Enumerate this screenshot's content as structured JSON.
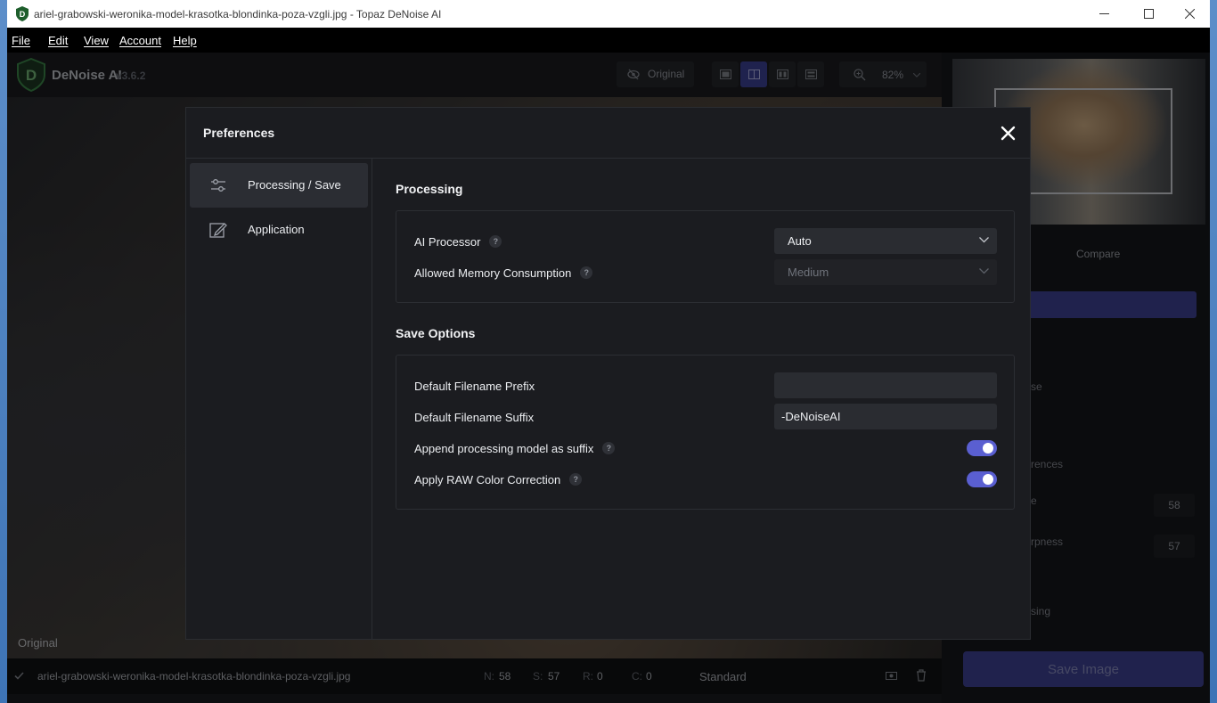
{
  "window": {
    "title": "ariel-grabowski-weronika-model-krasotka-blondinka-poza-vzgli.jpg - Topaz DeNoise AI",
    "controls": [
      "minimize-icon",
      "maximize-icon",
      "close-icon"
    ]
  },
  "menu": {
    "file": "File",
    "edit": "Edit",
    "view": "View",
    "account": "Account",
    "help": "Help"
  },
  "app": {
    "brand": "DeNoise AI",
    "version": "v3.6.2",
    "original_label": "Original",
    "zoom": "82%",
    "view_modes": [
      "single-view",
      "split-view",
      "side-by-side-view",
      "comparison-view"
    ],
    "active_view": "split-view"
  },
  "canvas": {
    "original_label": "Original"
  },
  "status": {
    "filename": "ariel-grabowski-weronika-model-krasotka-blondinka-poza-vzgli.jpg",
    "n_label": "N:",
    "n_value": "58",
    "s_label": "S:",
    "s_value": "57",
    "r_label": "R:",
    "r_value": "0",
    "c_label": "C:",
    "c_value": "0",
    "model": "Standard"
  },
  "right_panel": {
    "compare_label": "Compare",
    "fragments": {
      "a": "se",
      "b": "rences",
      "c": "e",
      "d": "rpness",
      "e": "sing"
    },
    "noise_value": "58",
    "sharpness_value": "57",
    "save_button": "Save Image",
    "accent_color": "#40449a"
  },
  "dialog": {
    "title": "Preferences",
    "nav": [
      {
        "label": "Processing / Save",
        "icon": "sliders-icon",
        "active": true
      },
      {
        "label": "Application",
        "icon": "edit-icon",
        "active": false
      }
    ],
    "processing": {
      "title": "Processing",
      "ai_processor_label": "AI Processor",
      "ai_processor_value": "Auto",
      "memory_label": "Allowed Memory Consumption",
      "memory_value": "Medium"
    },
    "save_options": {
      "title": "Save Options",
      "prefix_label": "Default Filename Prefix",
      "prefix_value": "",
      "suffix_label": "Default Filename Suffix",
      "suffix_value": "-DeNoiseAI",
      "append_model_label": "Append processing model as suffix",
      "append_model_on": true,
      "raw_correction_label": "Apply RAW Color Correction",
      "raw_correction_on": true
    },
    "help_glyph": "?",
    "toggle_color": "#5a5fd1"
  }
}
